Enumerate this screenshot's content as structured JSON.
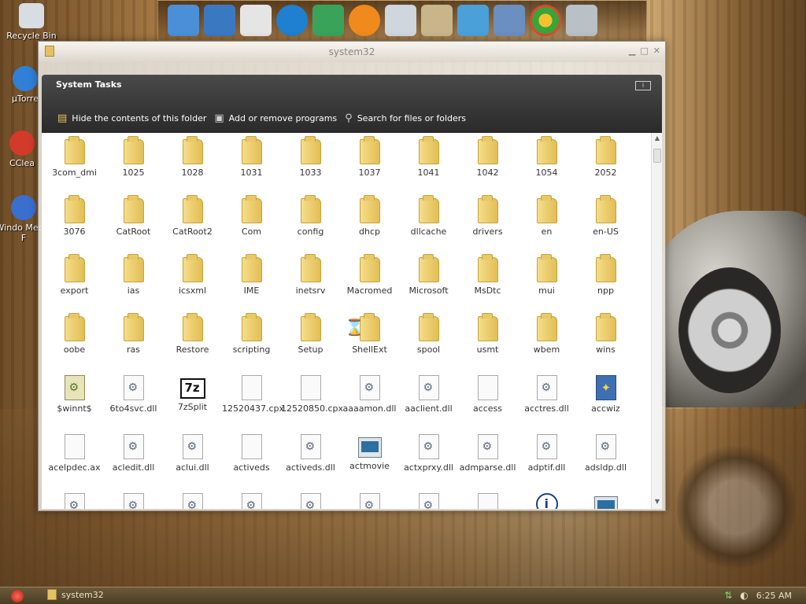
{
  "desktop": {
    "icons": [
      {
        "label": "Recycle Bin"
      },
      {
        "label": "µTorre"
      },
      {
        "label": "CClea"
      },
      {
        "label": "Windo Media F"
      }
    ]
  },
  "dock": {
    "items": [
      "computer-icon",
      "network-icon",
      "documents-icon",
      "internet-explorer-icon",
      "photo-icon",
      "media-player-icon",
      "calculator-icon",
      "paint-icon",
      "notepad-icon",
      "control-panel-icon",
      "windows-logo-icon",
      "recycle-bin-icon"
    ]
  },
  "window": {
    "title": "system32",
    "tasks": {
      "heading": "System Tasks",
      "info_button": "i",
      "links": [
        {
          "label": "Hide the contents of this folder",
          "icon": "folder-hide-icon"
        },
        {
          "label": "Add or remove programs",
          "icon": "programs-icon"
        },
        {
          "label": "Search for files or folders",
          "icon": "search-icon"
        }
      ]
    },
    "items": [
      {
        "name": "3com_dmi",
        "type": "folder"
      },
      {
        "name": "1025",
        "type": "folder"
      },
      {
        "name": "1028",
        "type": "folder"
      },
      {
        "name": "1031",
        "type": "folder"
      },
      {
        "name": "1033",
        "type": "folder"
      },
      {
        "name": "1037",
        "type": "folder"
      },
      {
        "name": "1041",
        "type": "folder"
      },
      {
        "name": "1042",
        "type": "folder"
      },
      {
        "name": "1054",
        "type": "folder"
      },
      {
        "name": "2052",
        "type": "folder"
      },
      {
        "name": "3076",
        "type": "folder"
      },
      {
        "name": "CatRoot",
        "type": "folder"
      },
      {
        "name": "CatRoot2",
        "type": "folder"
      },
      {
        "name": "Com",
        "type": "folder"
      },
      {
        "name": "config",
        "type": "folder"
      },
      {
        "name": "dhcp",
        "type": "folder"
      },
      {
        "name": "dllcache",
        "type": "folder"
      },
      {
        "name": "drivers",
        "type": "folder"
      },
      {
        "name": "en",
        "type": "folder"
      },
      {
        "name": "en-US",
        "type": "folder"
      },
      {
        "name": "export",
        "type": "folder"
      },
      {
        "name": "ias",
        "type": "folder"
      },
      {
        "name": "icsxml",
        "type": "folder"
      },
      {
        "name": "IME",
        "type": "folder"
      },
      {
        "name": "inetsrv",
        "type": "folder"
      },
      {
        "name": "Macromed",
        "type": "folder"
      },
      {
        "name": "Microsoft",
        "type": "folder"
      },
      {
        "name": "MsDtc",
        "type": "folder"
      },
      {
        "name": "mui",
        "type": "folder"
      },
      {
        "name": "npp",
        "type": "folder"
      },
      {
        "name": "oobe",
        "type": "folder"
      },
      {
        "name": "ras",
        "type": "folder"
      },
      {
        "name": "Restore",
        "type": "folder"
      },
      {
        "name": "scripting",
        "type": "folder"
      },
      {
        "name": "Setup",
        "type": "folder"
      },
      {
        "name": "ShellExt",
        "type": "folder"
      },
      {
        "name": "spool",
        "type": "folder"
      },
      {
        "name": "usmt",
        "type": "folder"
      },
      {
        "name": "wbem",
        "type": "folder"
      },
      {
        "name": "wins",
        "type": "folder"
      },
      {
        "name": "$winnt$",
        "type": "img"
      },
      {
        "name": "6to4svc.dll",
        "type": "dll"
      },
      {
        "name": "7zSplit",
        "type": "zip"
      },
      {
        "name": "12520437.cpx",
        "type": "blank"
      },
      {
        "name": "12520850.cpx",
        "type": "blank"
      },
      {
        "name": "aaaamon.dll",
        "type": "dll"
      },
      {
        "name": "aaclient.dll",
        "type": "dll"
      },
      {
        "name": "access",
        "type": "blank"
      },
      {
        "name": "acctres.dll",
        "type": "dll"
      },
      {
        "name": "accwiz",
        "type": "wiz"
      },
      {
        "name": "acelpdec.ax",
        "type": "blank"
      },
      {
        "name": "acledit.dll",
        "type": "dll"
      },
      {
        "name": "aclui.dll",
        "type": "dll"
      },
      {
        "name": "activeds",
        "type": "blank"
      },
      {
        "name": "activeds.dll",
        "type": "dll"
      },
      {
        "name": "actmovie",
        "type": "mov"
      },
      {
        "name": "actxprxy.dll",
        "type": "dll"
      },
      {
        "name": "admparse.dll",
        "type": "dll"
      },
      {
        "name": "adptif.dll",
        "type": "dll"
      },
      {
        "name": "adsldp.dll",
        "type": "dll"
      },
      {
        "name": "",
        "type": "dll"
      },
      {
        "name": "",
        "type": "dll"
      },
      {
        "name": "",
        "type": "dll"
      },
      {
        "name": "",
        "type": "dll"
      },
      {
        "name": "",
        "type": "dll"
      },
      {
        "name": "",
        "type": "dll"
      },
      {
        "name": "",
        "type": "dll"
      },
      {
        "name": "",
        "type": "blank"
      },
      {
        "name": "",
        "type": "info"
      },
      {
        "name": "",
        "type": "mov"
      }
    ]
  },
  "taskbar": {
    "task": "system32",
    "clock": "6:25 AM"
  }
}
